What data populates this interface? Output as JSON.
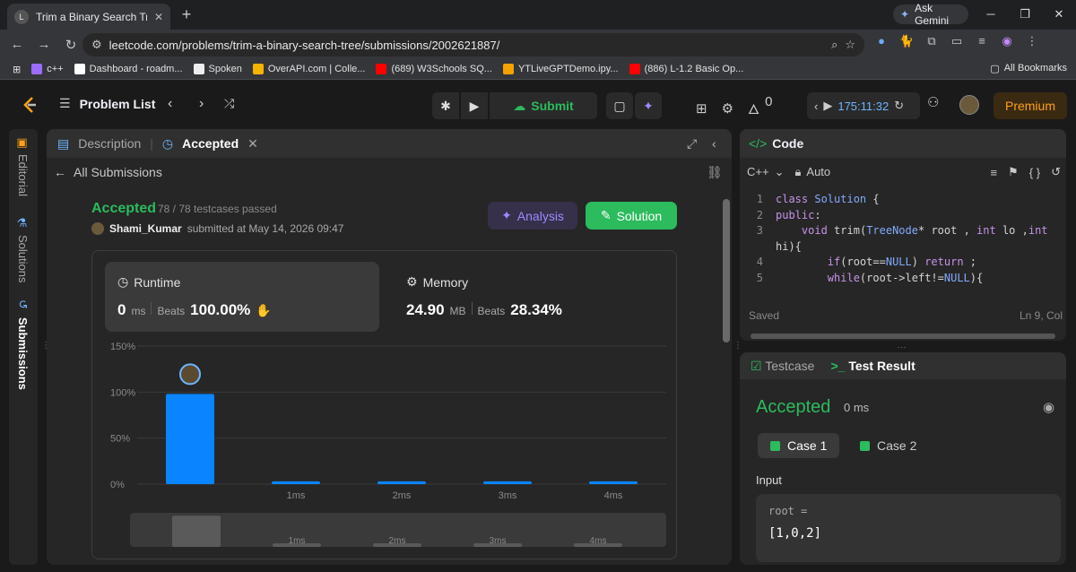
{
  "browser": {
    "tab_title": "Trim a Binary Search Tree - Leet",
    "tab_close": "✕",
    "new_tab": "+",
    "ask_gemini": "Ask Gemini",
    "url": "leetcode.com/problems/trim-a-binary-search-tree/submissions/2002621887/",
    "bookmarks": [
      {
        "label": "c++",
        "color": "#9c6cff"
      },
      {
        "label": "Dashboard - roadm...",
        "color": "#ffffff"
      },
      {
        "label": "Spoken",
        "color": "#ffffff"
      },
      {
        "label": "OverAPI.com | Colle...",
        "color": "#f4b400"
      },
      {
        "label": "(689) W3Schools SQ...",
        "color": "#ff0000"
      },
      {
        "label": "YTLiveGPTDemo.ipy...",
        "color": "#f4a300"
      },
      {
        "label": "(886) L-1.2 Basic Op...",
        "color": "#ff0000"
      }
    ],
    "all_bookmarks": "All Bookmarks"
  },
  "lc": {
    "problem_list": "Problem List",
    "submit": "Submit",
    "streak": "0",
    "timer": "175:11:32",
    "premium": "Premium"
  },
  "vtabs": {
    "editorial": "Editorial",
    "solutions": "Solutions",
    "submissions": "Submissions"
  },
  "left": {
    "tab_description": "Description",
    "tab_accepted": "Accepted",
    "all_submissions": "All Submissions",
    "status": "Accepted",
    "passed": "78 / 78 testcases passed",
    "user": "Shami_Kumar",
    "submitted_at": "submitted at May 14, 2026 09:47",
    "analysis": "Analysis",
    "solution": "Solution",
    "runtime": {
      "title": "Runtime",
      "value": "0",
      "unit": "ms",
      "beats_label": "Beats",
      "beats": "100.00%"
    },
    "memory": {
      "title": "Memory",
      "value": "24.90",
      "unit": "MB",
      "beats_label": "Beats",
      "beats": "28.34%"
    }
  },
  "chart_data": {
    "type": "bar",
    "categories": [
      "",
      "1ms",
      "2ms",
      "3ms",
      "4ms"
    ],
    "values": [
      98,
      3,
      3,
      3,
      3
    ],
    "ylim": [
      0,
      150
    ],
    "yticks": [
      "0%",
      "50%",
      "100%",
      "150%"
    ],
    "highlight_index": 0,
    "color": "#0a84ff",
    "grid": true,
    "mini_categories": [
      "",
      "1ms",
      "2ms",
      "3ms",
      "4ms"
    ]
  },
  "code": {
    "title": "Code",
    "language": "C++",
    "mode": "Auto",
    "lines": [
      {
        "n": "1",
        "html": "class Solution {"
      },
      {
        "n": "2",
        "html": "public:"
      },
      {
        "n": "3",
        "html": "    void trim(TreeNode* root , int lo ,int"
      },
      {
        "n": "",
        "html": "hi){"
      },
      {
        "n": "4",
        "html": "        if(root==NULL) return ;"
      },
      {
        "n": "5",
        "html": "        while(root->left!=NULL){"
      }
    ],
    "saved": "Saved",
    "position": "Ln 9, Col"
  },
  "test": {
    "tab_testcase": "Testcase",
    "tab_result": "Test Result",
    "status": "Accepted",
    "time": "0 ms",
    "case1": "Case 1",
    "case2": "Case 2",
    "input_label": "Input",
    "input_name": "root =",
    "input_value": "[1,0,2]"
  }
}
